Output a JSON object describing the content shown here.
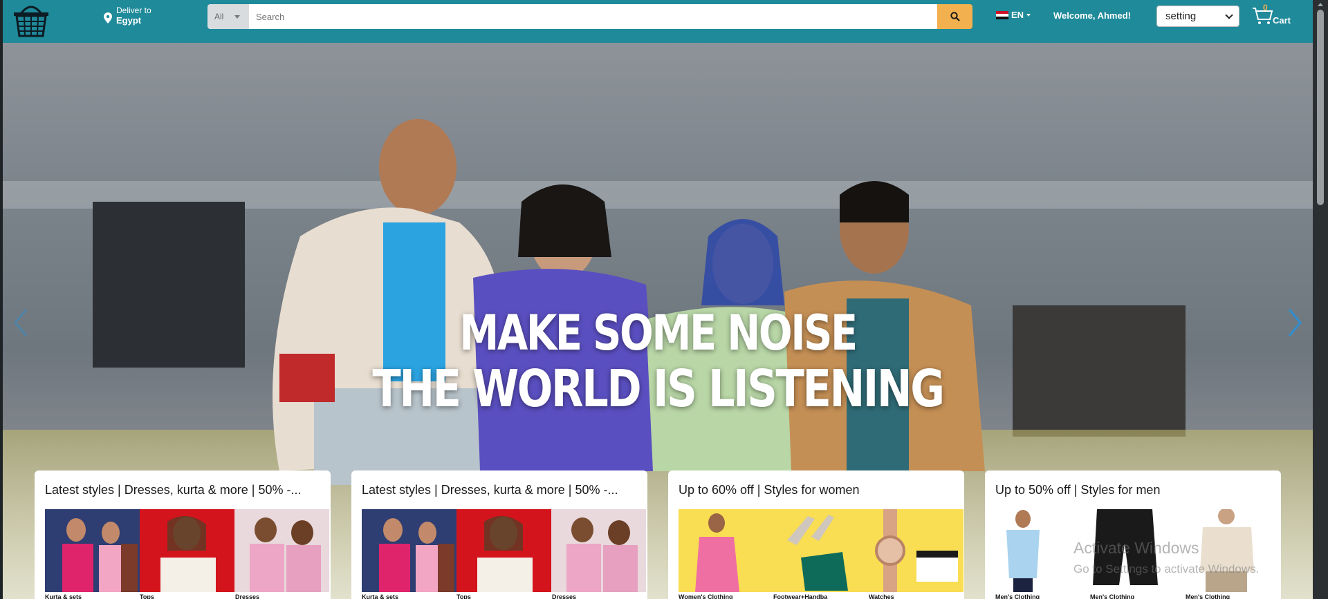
{
  "header": {
    "deliver_label": "Deliver to",
    "deliver_country": "Egypt",
    "search_category": "All",
    "search_placeholder": "Search",
    "language": "EN",
    "welcome": "Welcome, Ahmed!",
    "setting_selected": "setting",
    "cart_count": "0",
    "cart_label": "Cart",
    "colors": {
      "header_bg": "#1f8a9a",
      "search_button": "#f3b04e"
    }
  },
  "hero": {
    "line1": "MAKE SOME NOISE",
    "line2": "THE WORLD IS LISTENING"
  },
  "cards": [
    {
      "title": "Latest styles | Dresses, kurta & more | 50% -...",
      "captions": [
        "Kurta & sets",
        "Tops",
        "Dresses"
      ]
    },
    {
      "title": "Latest styles | Dresses, kurta & more | 50% -...",
      "captions": [
        "Kurta & sets",
        "Tops",
        "Dresses"
      ]
    },
    {
      "title": "Up to 60% off | Styles for women",
      "captions": [
        "Women's Clothing",
        "Footwear+Handba",
        "Watches"
      ]
    },
    {
      "title": "Up to 50% off | Styles for men",
      "captions": [
        "Men's Clothing",
        "Men's Clothing",
        "Men's Clothing"
      ]
    }
  ],
  "os_overlay": {
    "activate_title": "Activate Windows",
    "activate_sub": "Go to Settings to activate Windows."
  },
  "icons": [
    "basket-logo-icon",
    "location-pin-icon",
    "search-icon",
    "egypt-flag-icon",
    "cart-icon",
    "carousel-prev-icon",
    "carousel-next-icon"
  ]
}
